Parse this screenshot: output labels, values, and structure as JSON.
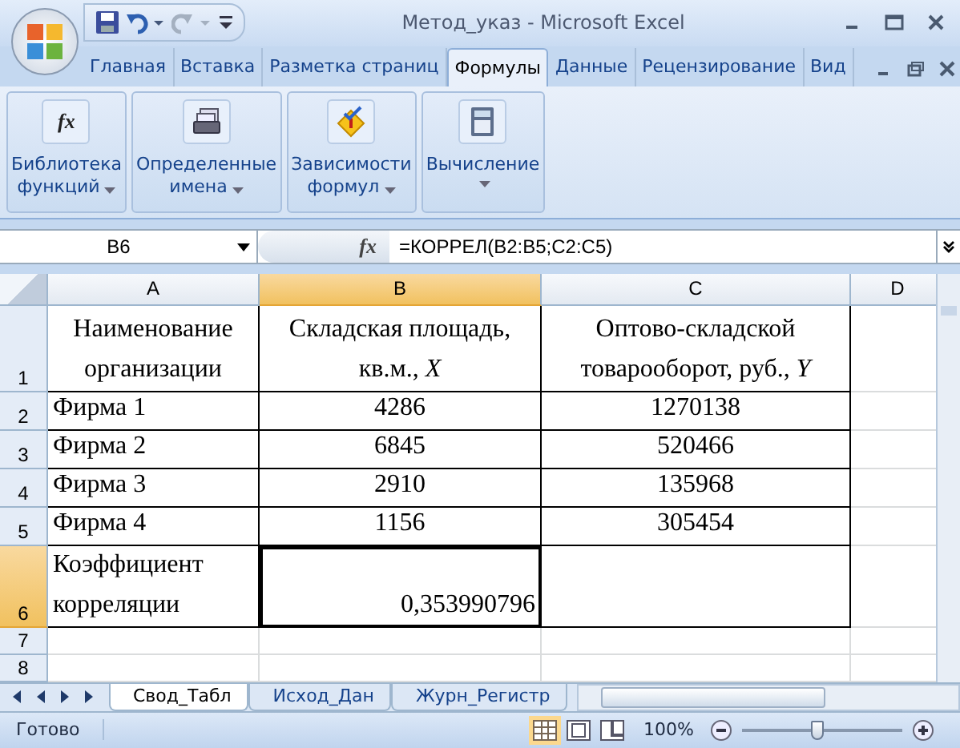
{
  "window": {
    "title": "Метод_указ  -  Microsoft Excel"
  },
  "ribbon_tabs": [
    {
      "label": "Главная",
      "selected": false
    },
    {
      "label": "Вставка",
      "selected": false
    },
    {
      "label": "Разметка страниц",
      "selected": false
    },
    {
      "label": "Формулы",
      "selected": true
    },
    {
      "label": "Данные",
      "selected": false
    },
    {
      "label": "Рецензирование",
      "selected": false
    },
    {
      "label": "Вид",
      "selected": false
    }
  ],
  "ribbon_groups": [
    {
      "kind": "function",
      "glyph": "fx",
      "lines": [
        "Библиотека",
        "функций"
      ]
    },
    {
      "kind": "names",
      "lines": [
        "Определенные",
        "имена"
      ]
    },
    {
      "kind": "audit",
      "lines": [
        "Зависимости",
        "формул"
      ]
    },
    {
      "kind": "calc",
      "lines": [
        "Вычисление"
      ]
    }
  ],
  "formula_bar": {
    "name_box": "B6",
    "fx": "fx",
    "formula": "=КОРРЕЛ(B2:B5;C2:C5)"
  },
  "columns": [
    {
      "label": "A",
      "selected": false
    },
    {
      "label": "B",
      "selected": true
    },
    {
      "label": "C",
      "selected": false
    },
    {
      "label": "D",
      "selected": false
    }
  ],
  "rows": [
    {
      "number": "1",
      "selected": false,
      "cells": [
        {
          "text": "Наименование организации",
          "kind": "header"
        },
        {
          "text": "Складская площадь, кв.м., *X*",
          "kind": "header"
        },
        {
          "text": "Оптово-складской товарооборот, руб., *Y*",
          "kind": "header"
        }
      ]
    },
    {
      "number": "2",
      "selected": false,
      "cells": [
        {
          "text": "Фирма 1",
          "kind": "text"
        },
        {
          "text": "4286",
          "kind": "number"
        },
        {
          "text": "1270138",
          "kind": "number"
        }
      ]
    },
    {
      "number": "3",
      "selected": false,
      "cells": [
        {
          "text": "Фирма 2",
          "kind": "text"
        },
        {
          "text": "6845",
          "kind": "number"
        },
        {
          "text": "520466",
          "kind": "number"
        }
      ]
    },
    {
      "number": "4",
      "selected": false,
      "cells": [
        {
          "text": "Фирма 3",
          "kind": "text"
        },
        {
          "text": "2910",
          "kind": "number"
        },
        {
          "text": "135968",
          "kind": "number"
        }
      ]
    },
    {
      "number": "5",
      "selected": false,
      "cells": [
        {
          "text": "Фирма 4",
          "kind": "text"
        },
        {
          "text": "1156",
          "kind": "number"
        },
        {
          "text": "305454",
          "kind": "number"
        }
      ]
    },
    {
      "number": "6",
      "selected": true,
      "cells": [
        {
          "text": "Коэффициент корреляции",
          "kind": "text"
        },
        {
          "text": "0,353990796",
          "kind": "result",
          "active": true
        },
        {
          "kind": "text"
        }
      ]
    },
    {
      "number": "7",
      "selected": false,
      "cells": []
    },
    {
      "number": "8",
      "selected": false,
      "cells": []
    }
  ],
  "sheet_tabs": [
    {
      "label": "Свод_Табл",
      "selected": true
    },
    {
      "label": "Исход_Дан",
      "selected": false
    },
    {
      "label": "Журн_Регистр",
      "selected": false
    }
  ],
  "status_bar": {
    "status": "Готово",
    "zoom": "100%",
    "level": 0.47
  }
}
